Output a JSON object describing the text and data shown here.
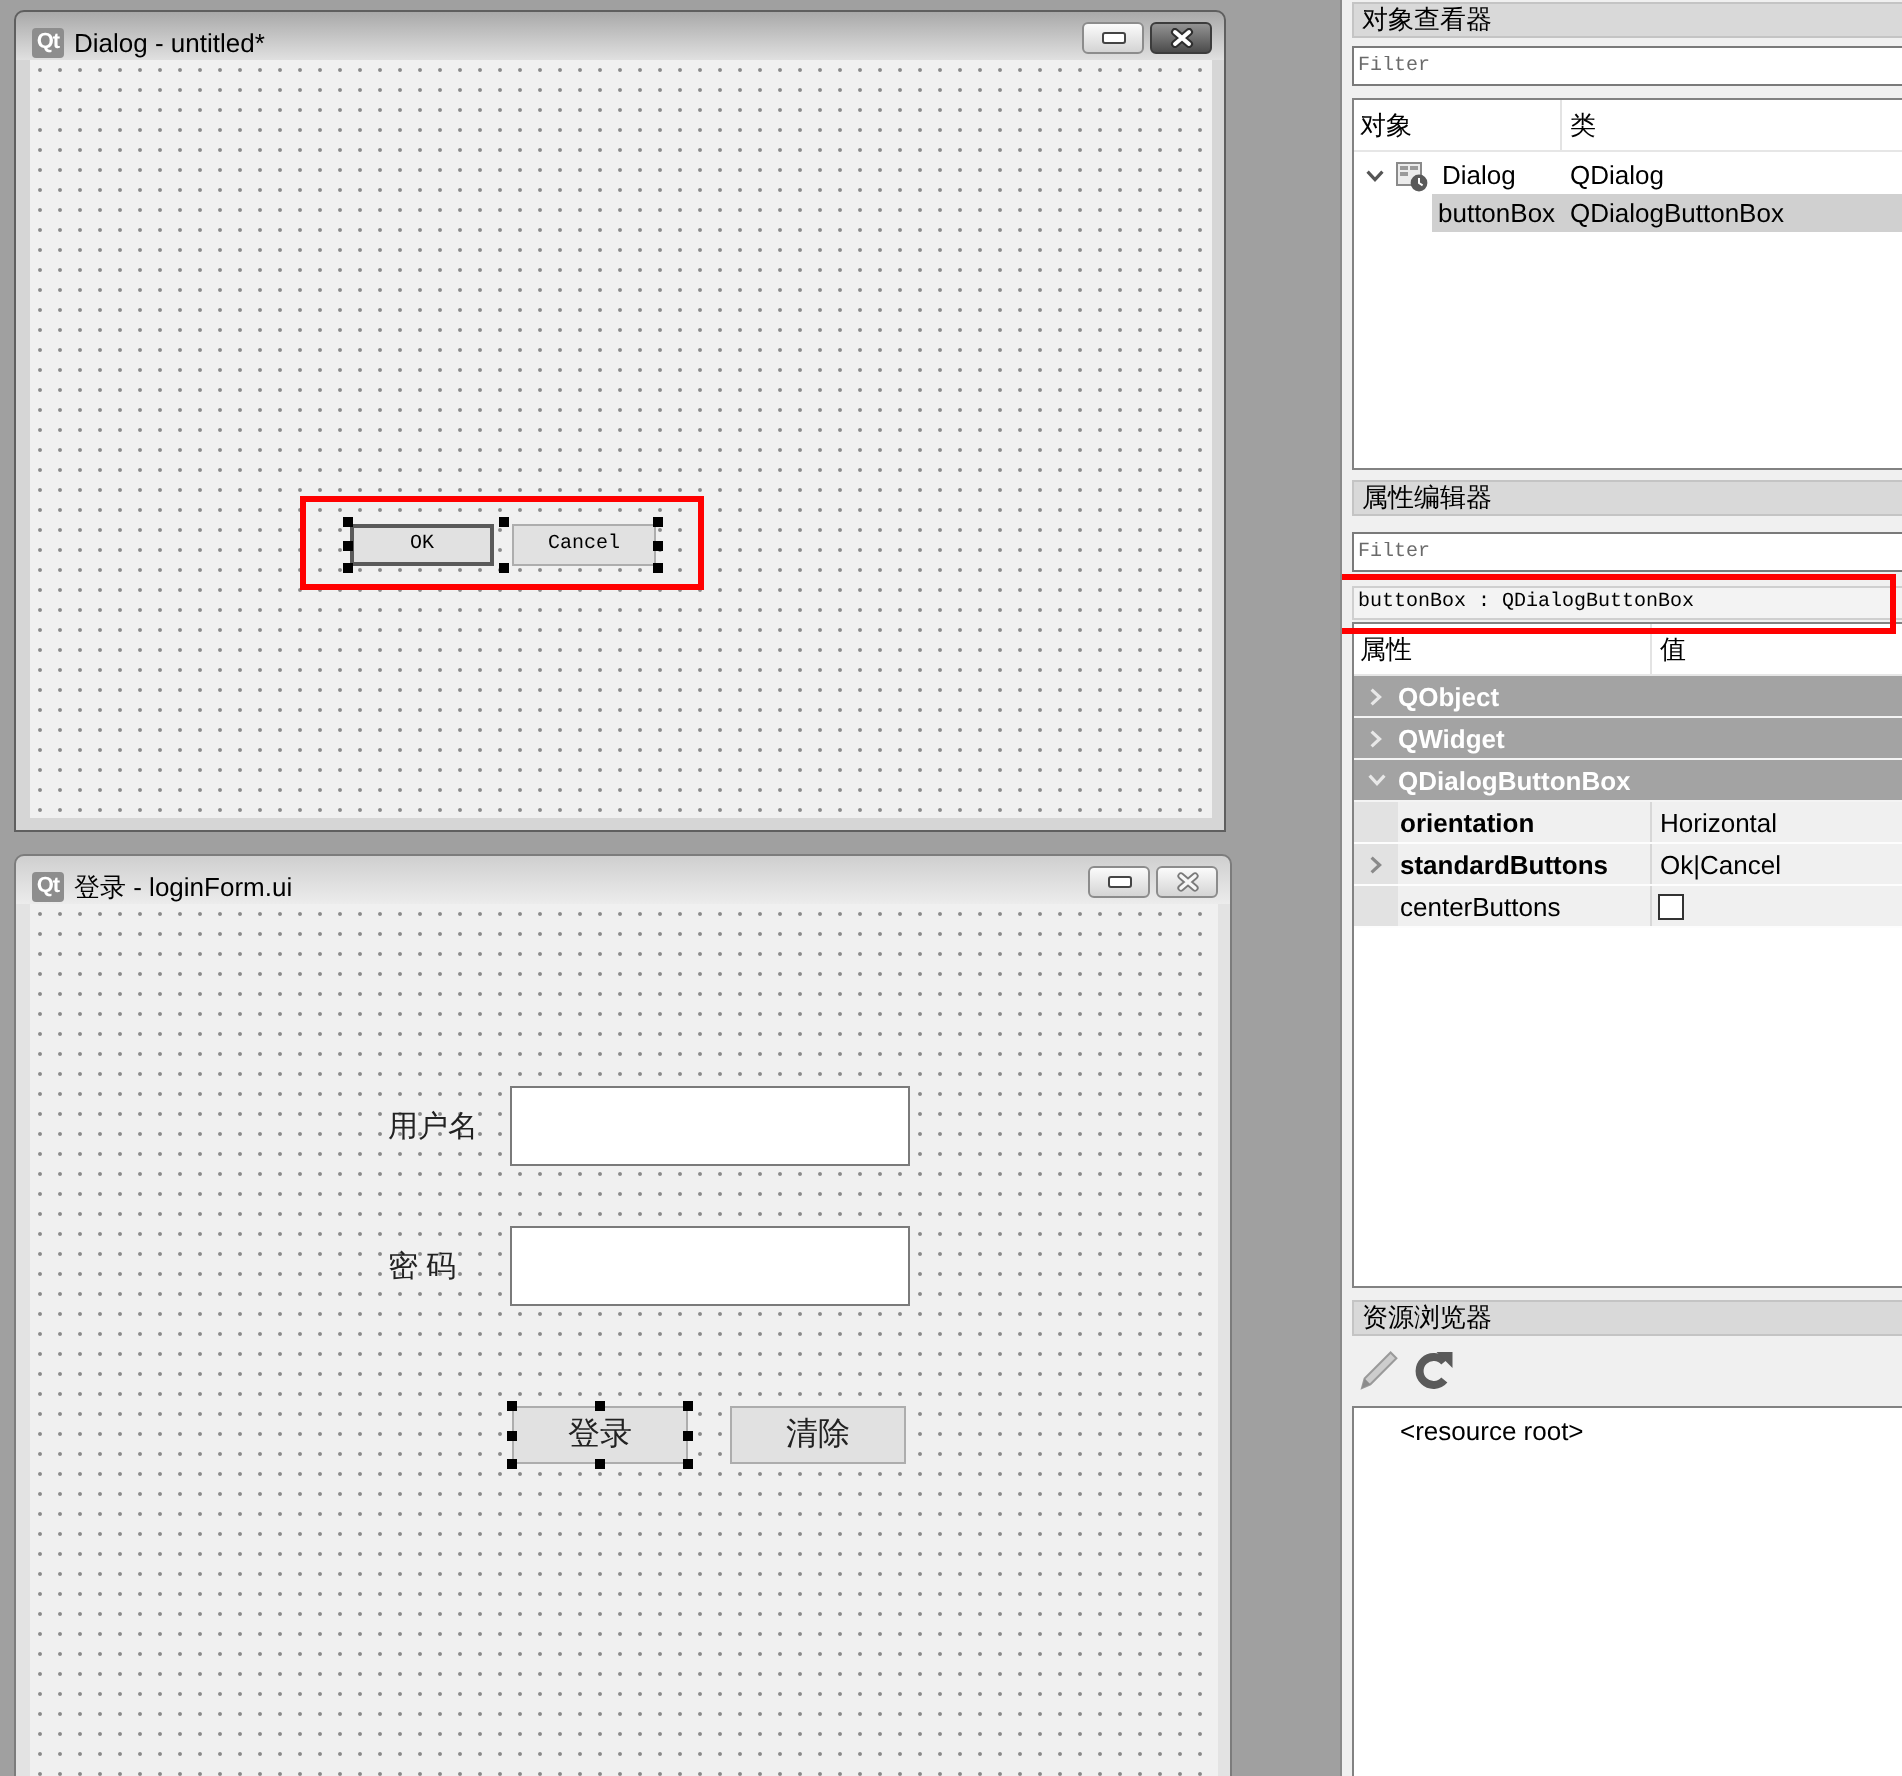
{
  "dialog_window": {
    "logo": "Qt",
    "title": "Dialog - untitled*",
    "active": true,
    "button_box": {
      "selected": true,
      "highlighted": true,
      "buttons": [
        {
          "label": "OK",
          "default": true
        },
        {
          "label": "Cancel",
          "default": false
        }
      ]
    }
  },
  "login_window": {
    "logo": "Qt",
    "title": "登录 - loginForm.ui",
    "active": false,
    "fields": [
      {
        "label": "用户名"
      },
      {
        "label": "密 码"
      }
    ],
    "buttons": [
      {
        "label": "登录",
        "selected": true
      },
      {
        "label": "清除",
        "selected": false
      }
    ]
  },
  "object_inspector": {
    "title": "对象查看器",
    "filter": {
      "placeholder": "Filter"
    },
    "columns": [
      "对象",
      "类"
    ],
    "tree": [
      {
        "kind": "form",
        "name": "Dialog",
        "class": "QDialog",
        "expanded": true,
        "selected": false,
        "children": [
          {
            "name": "buttonBox",
            "class": "QDialogButtonBox",
            "selected": true
          }
        ]
      }
    ]
  },
  "property_editor": {
    "title": "属性编辑器",
    "filter": {
      "placeholder": "Filter"
    },
    "object_label": {
      "text": "buttonBox : QDialogButtonBox",
      "highlighted": true
    },
    "columns": [
      "属性",
      "值"
    ],
    "rows": [
      {
        "kind": "group",
        "name": "QObject",
        "expanded": false
      },
      {
        "kind": "group",
        "name": "QWidget",
        "expanded": false
      },
      {
        "kind": "group",
        "name": "QDialogButtonBox",
        "expanded": true
      },
      {
        "kind": "text",
        "name": "orientation",
        "modified": true,
        "value": "Horizontal"
      },
      {
        "kind": "text",
        "name": "standardButtons",
        "modified": true,
        "expanded": false,
        "value": "Ok|Cancel"
      },
      {
        "kind": "checkbox",
        "name": "centerButtons",
        "modified": false,
        "checked": false
      }
    ]
  },
  "resource_browser": {
    "title": "资源浏览器",
    "tree": [
      {
        "name": "<resource root>"
      }
    ]
  }
}
